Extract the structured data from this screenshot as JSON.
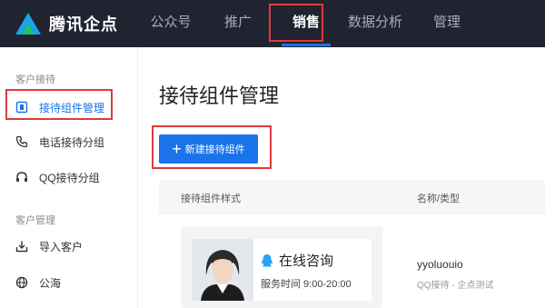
{
  "brand": {
    "name": "腾讯企点"
  },
  "nav": {
    "items": [
      {
        "label": "公众号"
      },
      {
        "label": "推广"
      },
      {
        "label": "销售"
      },
      {
        "label": "数据分析"
      },
      {
        "label": "管理"
      }
    ],
    "active_index": 2
  },
  "sidebar": {
    "group1": "客户接待",
    "items1": [
      {
        "label": "接待组件管理",
        "icon": "widget-icon"
      },
      {
        "label": "电话接待分组",
        "icon": "phone-icon"
      },
      {
        "label": "QQ接待分组",
        "icon": "headset-icon"
      }
    ],
    "group2": "客户管理",
    "items2": [
      {
        "label": "导入客户",
        "icon": "import-icon"
      },
      {
        "label": "公海",
        "icon": "globe-icon"
      }
    ]
  },
  "main": {
    "title": "接待组件管理",
    "new_button": "新建接待组件",
    "table": {
      "headers": [
        "接待组件样式",
        "名称/类型"
      ],
      "rows": [
        {
          "widget_title": "在线咨询",
          "widget_hours": "服务时间 9:00-20:00",
          "name": "yyoluouio",
          "type": "QQ接待 - 企点测试"
        }
      ]
    }
  },
  "colors": {
    "accent": "#1a73e8",
    "topbar": "#1f2430",
    "highlight": "#e0393e"
  }
}
